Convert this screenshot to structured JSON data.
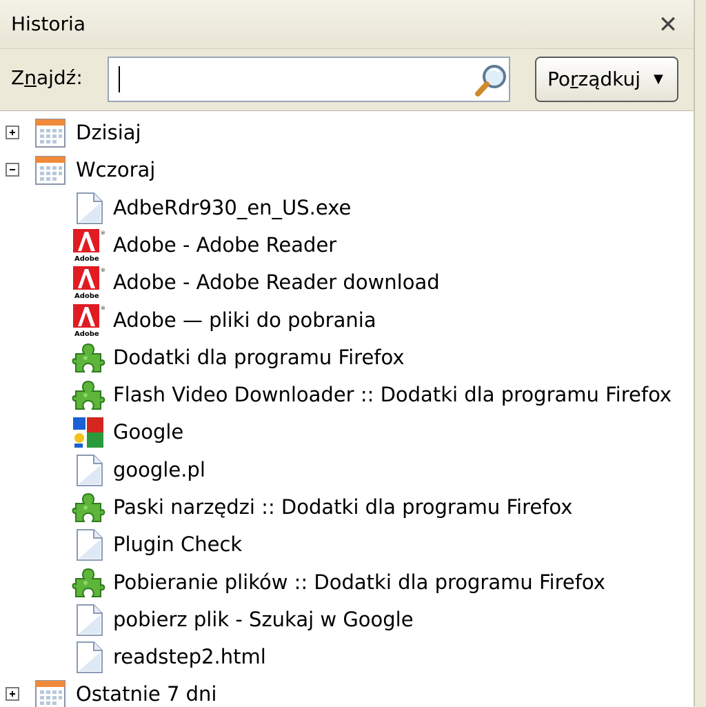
{
  "panel": {
    "title": "Historia"
  },
  "search": {
    "label_pre": "Z",
    "label_u": "n",
    "label_post": "ajdź:",
    "value": ""
  },
  "sort_button": {
    "label_pre": "Po",
    "label_u": "r",
    "label_post": "ządkuj"
  },
  "groups": [
    {
      "label": "Dzisiaj",
      "expanded": false
    },
    {
      "label": "Wczoraj",
      "expanded": true
    },
    {
      "label": "Ostatnie 7 dni",
      "expanded": false
    }
  ],
  "entries": [
    {
      "label": "AdbeRdr930_en_US.exe",
      "icon": "page-icon"
    },
    {
      "label": "Adobe - Adobe Reader",
      "icon": "adobe-icon"
    },
    {
      "label": "Adobe - Adobe Reader download",
      "icon": "adobe-icon"
    },
    {
      "label": "Adobe — pliki do pobrania",
      "icon": "adobe-icon"
    },
    {
      "label": "Dodatki dla programu Firefox",
      "icon": "puzzle-icon"
    },
    {
      "label": "Flash Video Downloader :: Dodatki dla programu Firefox",
      "icon": "puzzle-icon"
    },
    {
      "label": "Google",
      "icon": "google-icon"
    },
    {
      "label": "google.pl",
      "icon": "page-icon"
    },
    {
      "label": "Paski narzędzi :: Dodatki dla programu Firefox",
      "icon": "puzzle-icon"
    },
    {
      "label": "Plugin Check",
      "icon": "page-icon"
    },
    {
      "label": "Pobieranie plików :: Dodatki dla programu Firefox",
      "icon": "puzzle-icon"
    },
    {
      "label": "pobierz plik - Szukaj w Google",
      "icon": "page-icon"
    },
    {
      "label": "readstep2.html",
      "icon": "page-icon"
    }
  ]
}
